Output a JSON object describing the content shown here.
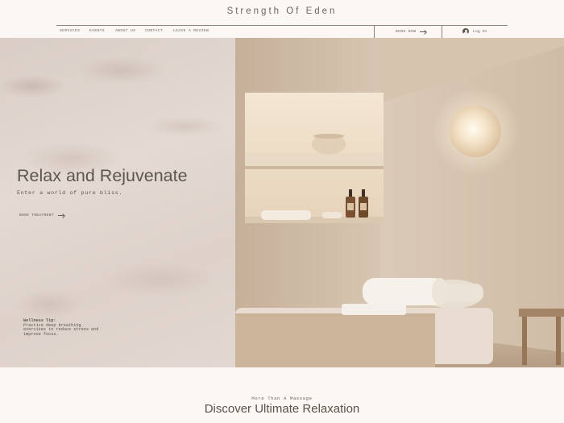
{
  "header": {
    "site_title": "Strength Of Eden",
    "nav": [
      "SERVICES",
      "EVENTS",
      "ABOUT US",
      "CONTACT",
      "LEAVE A REVIEW"
    ],
    "book_now": "BOOK NOW",
    "login": "Log In"
  },
  "hero": {
    "headline": "Relax and Rejuvenate",
    "subheadline": "Enter a world of pure bliss.",
    "cta": "BOOK TREATMENT",
    "tip_title": "Wellness Tip:",
    "tip_body": "Practice deep breathing exercises to reduce stress and improve focus."
  },
  "section": {
    "kicker": "More Than A Massage",
    "title": "Discover Ultimate Relaxation"
  },
  "icons": {
    "user": "user-icon",
    "arrow": "arrow-right-icon"
  },
  "colors": {
    "background": "#fbf7f4",
    "text": "#5a524b",
    "hero_left": "#e0d4cd",
    "hero_right": "#d3c1ac"
  }
}
